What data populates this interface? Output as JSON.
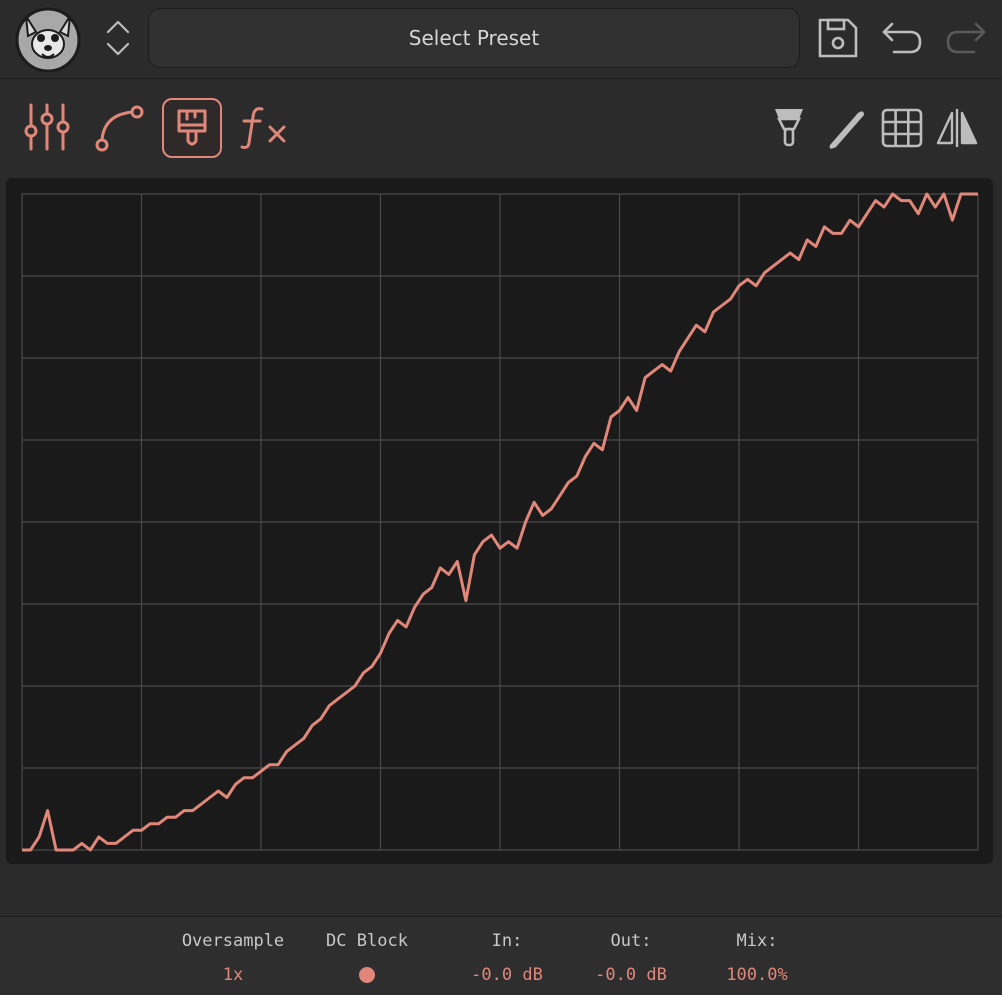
{
  "accent_color": "#e0877a",
  "header": {
    "preset_label": "Select Preset",
    "icons": [
      "fox-logo-icon",
      "chevron-updown-icon",
      "save-icon",
      "undo-icon",
      "redo-icon"
    ]
  },
  "toolbar": {
    "left_tools": [
      "sliders-icon",
      "curve-icon",
      "brush-icon",
      "fx-icon"
    ],
    "active_tool": "brush-icon",
    "right_tools": [
      "paint-bucket-icon",
      "pencil-icon",
      "grid-icon",
      "mirror-icon"
    ]
  },
  "graph": {
    "grid_columns": 8,
    "grid_rows": 8,
    "line_color": "#e0877a",
    "curve_y": [
      0.0,
      0.0,
      0.02,
      0.06,
      0.0,
      0.0,
      0.0,
      0.01,
      0.0,
      0.02,
      0.01,
      0.01,
      0.02,
      0.03,
      0.03,
      0.04,
      0.04,
      0.05,
      0.05,
      0.06,
      0.06,
      0.07,
      0.08,
      0.09,
      0.08,
      0.1,
      0.11,
      0.11,
      0.12,
      0.13,
      0.13,
      0.15,
      0.16,
      0.17,
      0.19,
      0.2,
      0.22,
      0.23,
      0.24,
      0.25,
      0.27,
      0.28,
      0.3,
      0.33,
      0.35,
      0.34,
      0.37,
      0.39,
      0.4,
      0.43,
      0.42,
      0.44,
      0.38,
      0.45,
      0.47,
      0.48,
      0.46,
      0.47,
      0.46,
      0.5,
      0.53,
      0.51,
      0.52,
      0.54,
      0.56,
      0.57,
      0.6,
      0.62,
      0.61,
      0.66,
      0.67,
      0.69,
      0.67,
      0.72,
      0.73,
      0.74,
      0.73,
      0.76,
      0.78,
      0.8,
      0.79,
      0.82,
      0.83,
      0.84,
      0.86,
      0.87,
      0.86,
      0.88,
      0.89,
      0.9,
      0.91,
      0.9,
      0.93,
      0.92,
      0.95,
      0.94,
      0.94,
      0.96,
      0.95,
      0.97,
      0.99,
      0.98,
      1.0,
      0.99,
      0.99,
      0.97,
      1.0,
      0.98,
      1.0,
      0.96,
      1.0,
      1.0,
      1.0
    ],
    "series_name": ""
  },
  "footer": {
    "oversample_label": "Oversample",
    "oversample_value": "1x",
    "dc_block_label": "DC Block",
    "in_label": "In:",
    "in_value": "-0.0 dB",
    "out_label": "Out:",
    "out_value": "-0.0 dB",
    "mix_label": "Mix:",
    "mix_value": "100.0%"
  }
}
